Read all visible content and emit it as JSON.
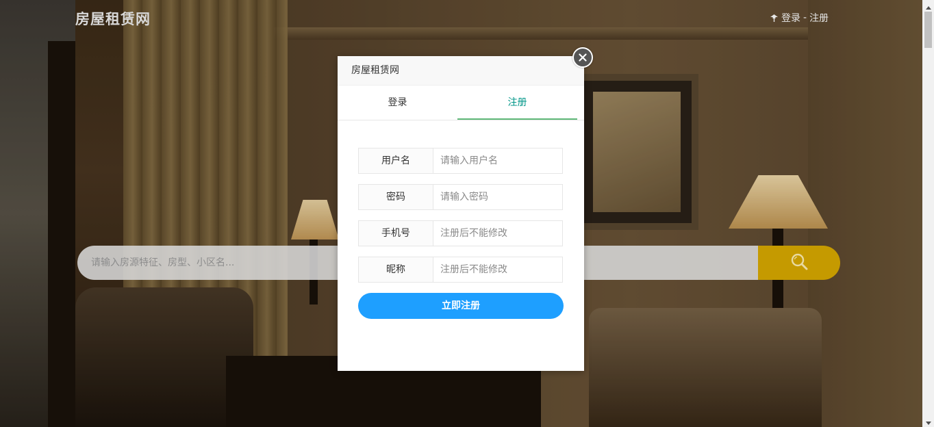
{
  "header": {
    "logo": "房屋租赁网",
    "login_link": "登录",
    "separator": "-",
    "register_link": "注册"
  },
  "search": {
    "placeholder": "请输入房源特征、房型、小区名..."
  },
  "modal": {
    "title": "房屋租赁网",
    "tabs": [
      {
        "label": "登录",
        "active": false
      },
      {
        "label": "注册",
        "active": true
      }
    ],
    "fields": [
      {
        "label": "用户名",
        "placeholder": "请输入用户名"
      },
      {
        "label": "密码",
        "placeholder": "请输入密码"
      },
      {
        "label": "手机号",
        "placeholder": "注册后不能修改"
      },
      {
        "label": "昵称",
        "placeholder": "注册后不能修改"
      }
    ],
    "submit_label": "立即注册"
  },
  "icons": {
    "user": "user-icon",
    "search": "search-icon",
    "close": "close-icon"
  },
  "colors": {
    "active_tab": "#009688",
    "tab_underline": "#5fb878",
    "submit": "#1e9fff",
    "search_button": "#c59a00"
  }
}
